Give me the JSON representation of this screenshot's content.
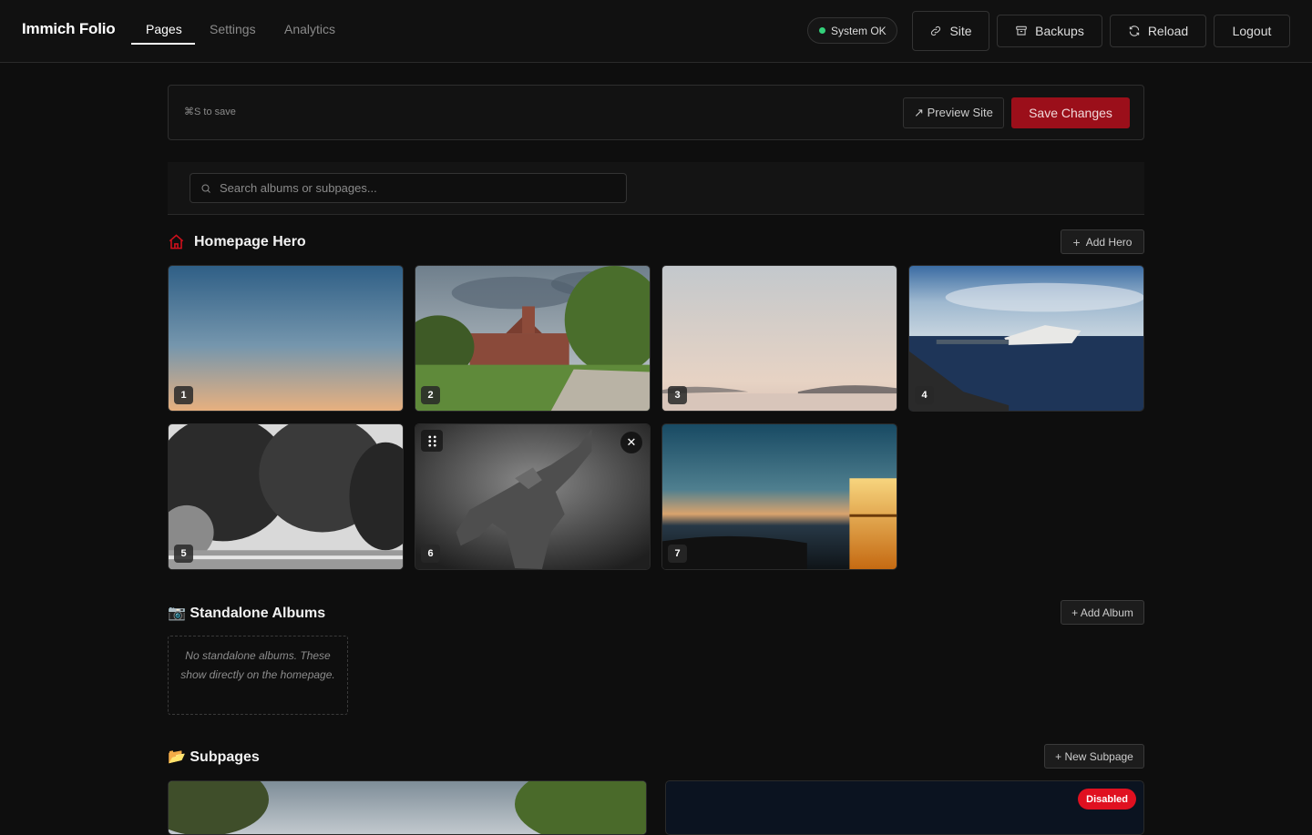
{
  "app": {
    "title": "Immich Folio"
  },
  "nav": {
    "tabs": [
      {
        "label": "Pages"
      },
      {
        "label": "Settings"
      },
      {
        "label": "Analytics"
      }
    ]
  },
  "header": {
    "status": "System OK",
    "site_label": "Site",
    "backups_label": "Backups",
    "reload_label": "Reload",
    "logout_label": "Logout"
  },
  "savebar": {
    "hint": "⌘S to save",
    "preview_label": "↗ Preview Site",
    "save_label": "Save Changes"
  },
  "search": {
    "placeholder": "Search albums or subpages..."
  },
  "hero": {
    "title": "Homepage Hero",
    "add_label": "Add Hero",
    "items": [
      {
        "index": "1"
      },
      {
        "index": "2"
      },
      {
        "index": "3"
      },
      {
        "index": "4"
      },
      {
        "index": "5"
      },
      {
        "index": "6"
      },
      {
        "index": "7"
      }
    ],
    "remove_glyph": "✕"
  },
  "albums": {
    "title": "📷 Standalone Albums",
    "add_label": "+ Add Album",
    "empty_text": "No standalone albums. These show directly on the homepage."
  },
  "subpages": {
    "title": "📂 Subpages",
    "add_label": "+ New Subpage",
    "disabled_badge": "Disabled"
  },
  "colors": {
    "accent": "#9b0f1a",
    "status_ok": "#33d17a",
    "danger": "#e01020"
  }
}
